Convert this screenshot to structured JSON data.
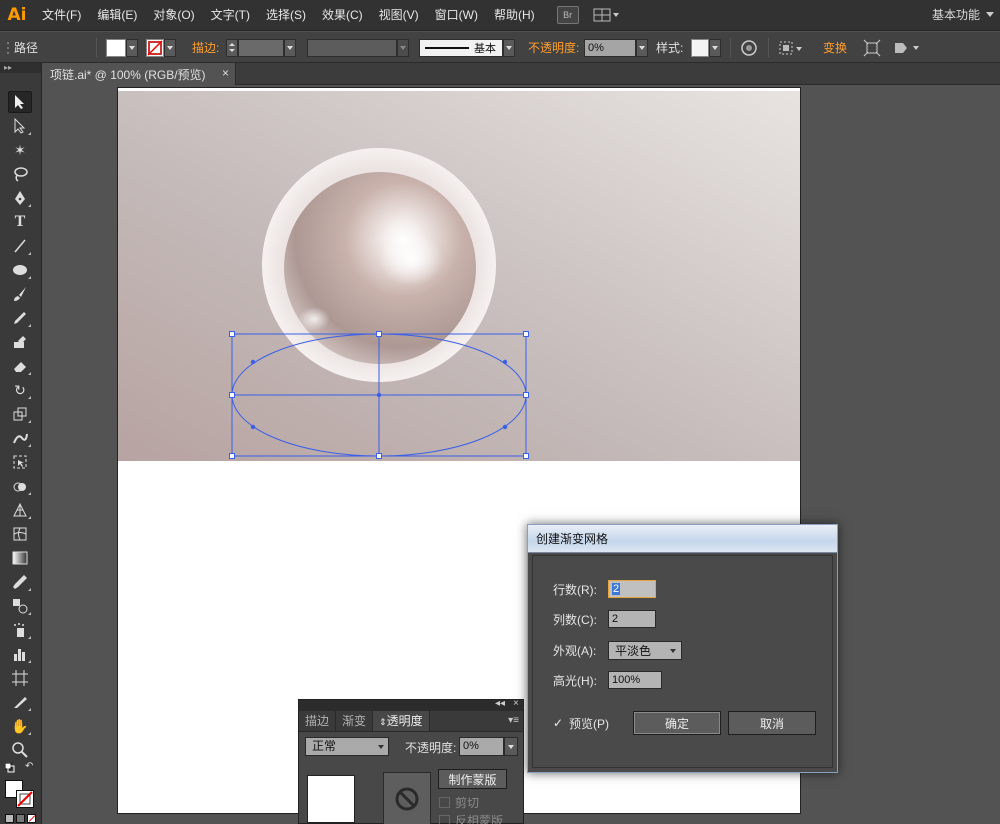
{
  "app": {
    "logo": "Ai",
    "menus": [
      "文件(F)",
      "编辑(E)",
      "对象(O)",
      "文字(T)",
      "选择(S)",
      "效果(C)",
      "视图(V)",
      "窗口(W)",
      "帮助(H)"
    ],
    "bridge_icon": "Br",
    "workspace": "基本功能"
  },
  "control_bar": {
    "selection_type": "路径",
    "stroke_label": "描边:",
    "stroke_profile": "基本",
    "opacity_label": "不透明度:",
    "opacity_value": "0%",
    "style_label": "样式:",
    "transform_label": "变换"
  },
  "document_tab": {
    "title": "项链.ai* @ 100% (RGB/预览)",
    "close": "×"
  },
  "toolbox": {
    "collapse": "▸▸",
    "tools": [
      "selection-tool",
      "direct-selection-tool",
      "magic-wand-tool",
      "lasso-tool",
      "pen-tool",
      "type-tool",
      "line-segment-tool",
      "ellipse-tool",
      "paintbrush-tool",
      "pencil-tool",
      "blob-brush-tool",
      "eraser-tool",
      "rotate-tool",
      "scale-tool",
      "warp-tool",
      "free-transform-tool",
      "shape-builder-tool",
      "perspective-grid-tool",
      "mesh-tool",
      "gradient-tool",
      "eyedropper-tool",
      "blend-tool",
      "symbol-sprayer-tool",
      "column-graph-tool",
      "artboard-tool",
      "slice-tool",
      "hand-tool",
      "zoom-tool"
    ]
  },
  "dialog": {
    "title": "创建渐变网格",
    "rows_label": "行数(R):",
    "rows_value": "2",
    "cols_label": "列数(C):",
    "cols_value": "2",
    "appearance_label": "外观(A):",
    "appearance_value": "平淡色",
    "highlight_label": "高光(H):",
    "highlight_value": "100%",
    "preview_label": "预览(P)",
    "preview_checked": true,
    "ok": "确定",
    "cancel": "取消"
  },
  "transparency_panel": {
    "tabs": [
      "描边",
      "渐变",
      "透明度"
    ],
    "active_tab": "透明度",
    "blend_mode": "正常",
    "opacity_label": "不透明度:",
    "opacity_value": "0%",
    "make_mask": "制作蒙版",
    "clip": "剪切",
    "invert_mask": "反相蒙版"
  },
  "colors": {
    "accent_orange": "#ff9a00",
    "ui_dark": "#323232",
    "selection_blue": "#3a5fe8"
  }
}
